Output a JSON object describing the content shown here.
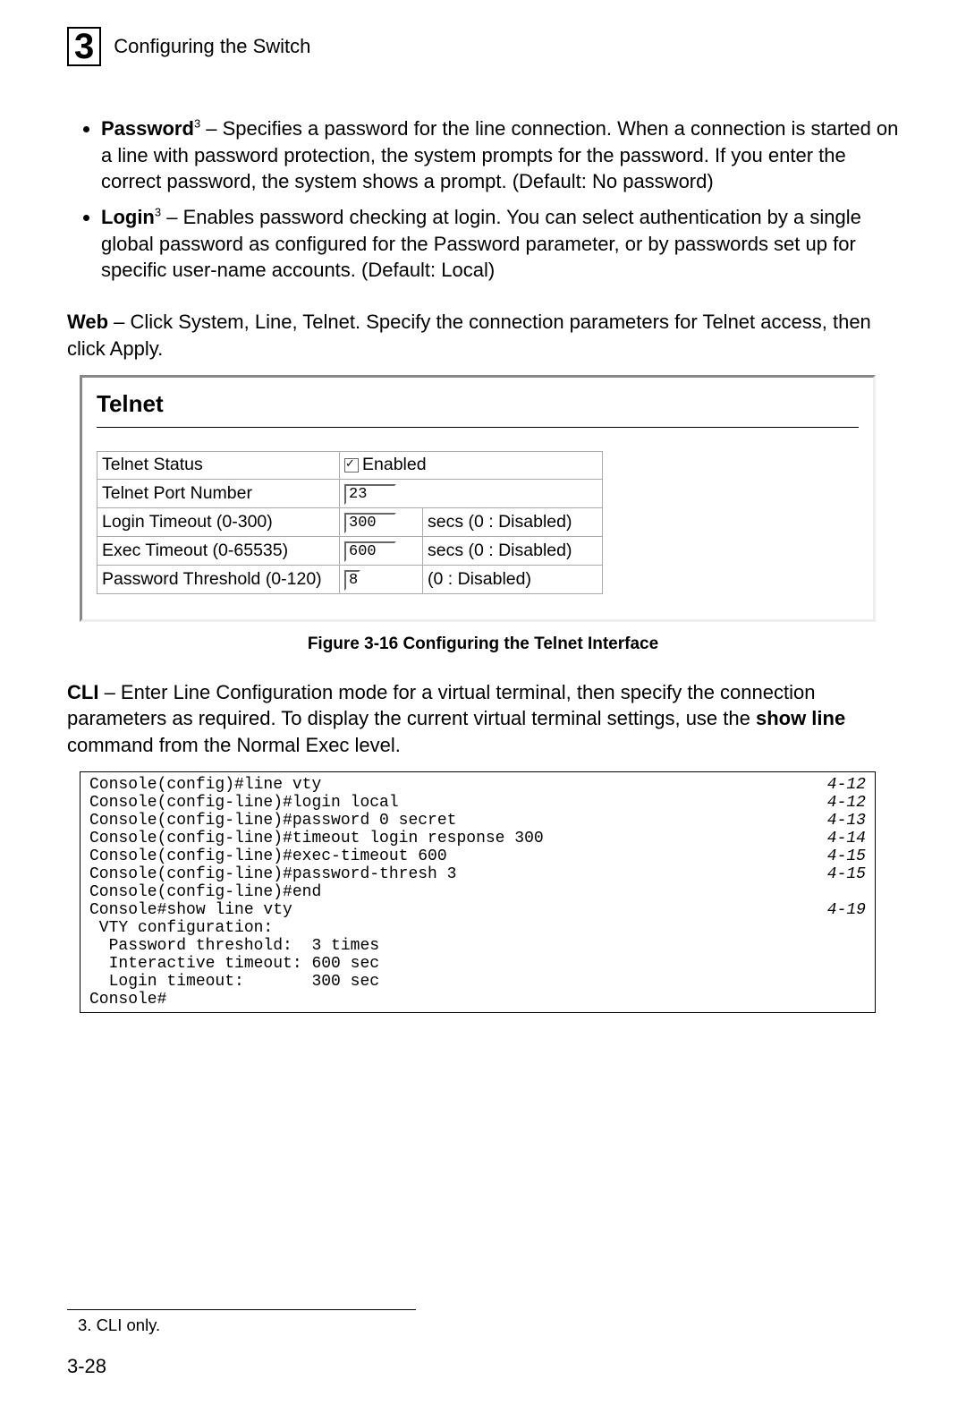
{
  "chapter": {
    "number": "3",
    "title": "Configuring the Switch"
  },
  "bullets": {
    "password": {
      "term": "Password",
      "sup": "3",
      "text": " – Specifies a password for the line connection. When a connection is started on a line with password protection, the system prompts for the password. If you enter the correct password, the system shows a prompt. (Default: No password)"
    },
    "login": {
      "term": "Login",
      "sup": "3",
      "text": " – Enables password checking at login. You can select authentication by a single global password as configured for the Password parameter, or by passwords set up for specific user-name accounts. (Default: Local)"
    }
  },
  "web": {
    "lead": "Web",
    "text": " – Click System, Line, Telnet. Specify the connection parameters for Telnet access, then click Apply."
  },
  "figure": {
    "heading": "Telnet",
    "rows": {
      "r1": {
        "label": "Telnet Status",
        "chk_label": "Enabled"
      },
      "r2": {
        "label": "Telnet Port Number",
        "value": "23"
      },
      "r3": {
        "label": "Login Timeout (0-300)",
        "value": "300",
        "hint": "secs (0 : Disabled)"
      },
      "r4": {
        "label": "Exec Timeout (0-65535)",
        "value": "600",
        "hint": "secs (0 : Disabled)"
      },
      "r5": {
        "label": "Password Threshold (0-120)",
        "value": "8",
        "hint": "(0 : Disabled)"
      }
    },
    "caption": "Figure 3-16   Configuring the Telnet Interface"
  },
  "cli": {
    "lead": "CLI",
    "text_a": " – Enter Line Configuration mode for a virtual terminal, then specify the connection parameters as required. To display the current virtual terminal settings, use the ",
    "bold_cmd": "show line",
    "text_b": " command from the Normal Exec level."
  },
  "console": {
    "l1": {
      "cmd": "Console(config)#line vty",
      "ref": "4-12"
    },
    "l2": {
      "cmd": "Console(config-line)#login local",
      "ref": "4-12"
    },
    "l3": {
      "cmd": "Console(config-line)#password 0 secret",
      "ref": "4-13"
    },
    "l4": {
      "cmd": "Console(config-line)#timeout login response 300",
      "ref": "4-14"
    },
    "l5": {
      "cmd": "Console(config-line)#exec-timeout 600",
      "ref": "4-15"
    },
    "l6": {
      "cmd": "Console(config-line)#password-thresh 3",
      "ref": "4-15"
    },
    "l7": {
      "cmd": "Console(config-line)#end"
    },
    "l8": {
      "cmd": "Console#show line vty",
      "ref": "4-19"
    },
    "l9": {
      "cmd": " VTY configuration:"
    },
    "l10": {
      "cmd": "  Password threshold:  3 times"
    },
    "l11": {
      "cmd": "  Interactive timeout: 600 sec"
    },
    "l12": {
      "cmd": "  Login timeout:       300 sec"
    },
    "l13": {
      "cmd": "Console#"
    }
  },
  "footnote": "3.  CLI only.",
  "pagenum": "3-28"
}
